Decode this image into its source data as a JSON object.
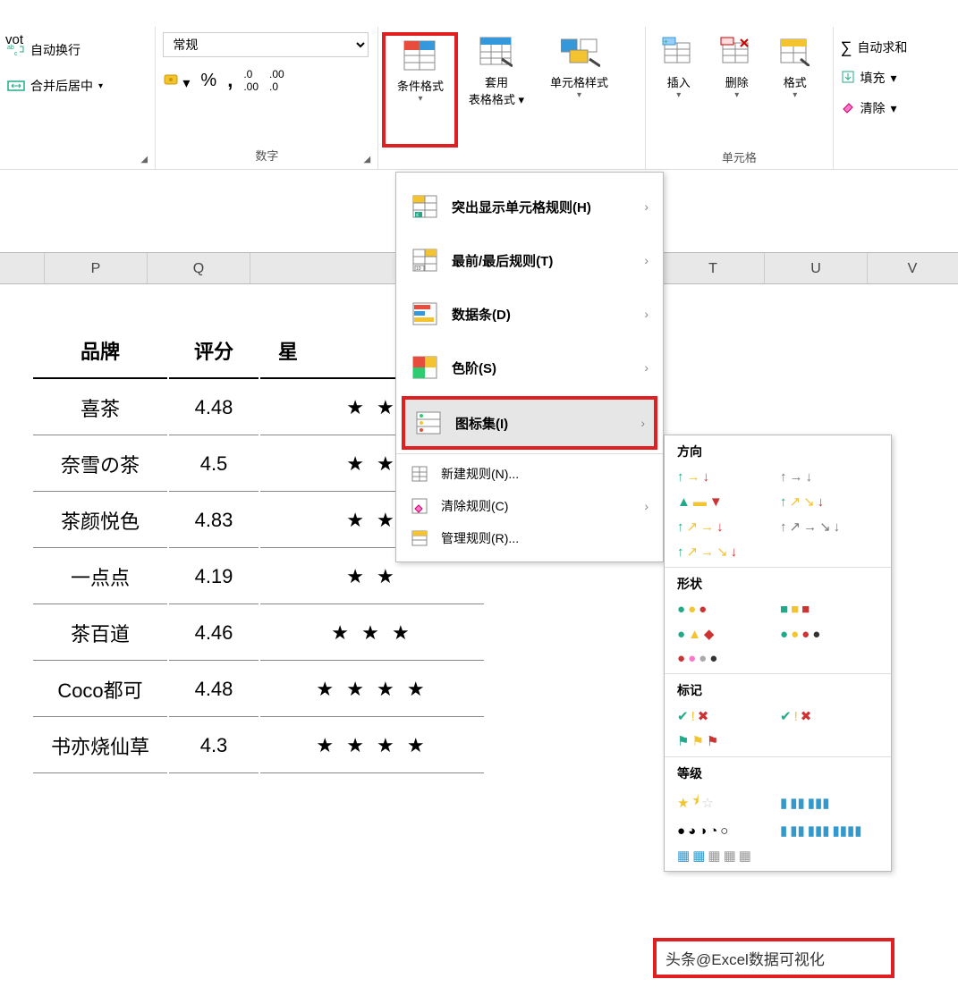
{
  "titlebar": "vot",
  "ribbon": {
    "align": {
      "wrap": "自动换行",
      "merge": "合并后居中"
    },
    "number": {
      "format": "常规",
      "group_label": "数字"
    },
    "styles": {
      "cond_format": "条件格式",
      "table_format_l1": "套用",
      "table_format_l2": "表格格式",
      "cell_style": "单元格样式"
    },
    "cells": {
      "insert": "插入",
      "delete": "删除",
      "format": "格式",
      "group_label": "单元格"
    },
    "editing": {
      "autosum": "自动求和",
      "fill": "填充",
      "clear": "清除"
    }
  },
  "cf_menu": {
    "highlight_rules": "突出显示单元格规则(H)",
    "top_bottom": "最前/最后规则(T)",
    "data_bars": "数据条(D)",
    "color_scales": "色阶(S)",
    "icon_sets": "图标集(I)",
    "new_rule": "新建规则(N)...",
    "clear_rules": "清除规则(C)",
    "manage_rules": "管理规则(R)..."
  },
  "iconset": {
    "direction": "方向",
    "shapes": "形状",
    "indicators": "标记",
    "ratings": "等级"
  },
  "columns": {
    "P": "P",
    "Q": "Q",
    "T": "T",
    "U": "U",
    "V": "V"
  },
  "table": {
    "headers": {
      "brand": "品牌",
      "score": "评分",
      "stars": "星"
    },
    "rows": [
      {
        "brand": "喜茶",
        "score": "4.48",
        "stars": "★ ★"
      },
      {
        "brand": "奈雪の茶",
        "score": "4.5",
        "stars": "★ ★"
      },
      {
        "brand": "茶颜悦色",
        "score": "4.83",
        "stars": "★ ★"
      },
      {
        "brand": "一点点",
        "score": "4.19",
        "stars": "★ ★"
      },
      {
        "brand": "茶百道",
        "score": "4.46",
        "stars": "★ ★ ★"
      },
      {
        "brand": "Coco都可",
        "score": "4.48",
        "stars": "★ ★ ★ ★"
      },
      {
        "brand": "书亦烧仙草",
        "score": "4.3",
        "stars": "★ ★ ★ ★"
      }
    ]
  },
  "watermark": "头条@Excel数据可视化"
}
